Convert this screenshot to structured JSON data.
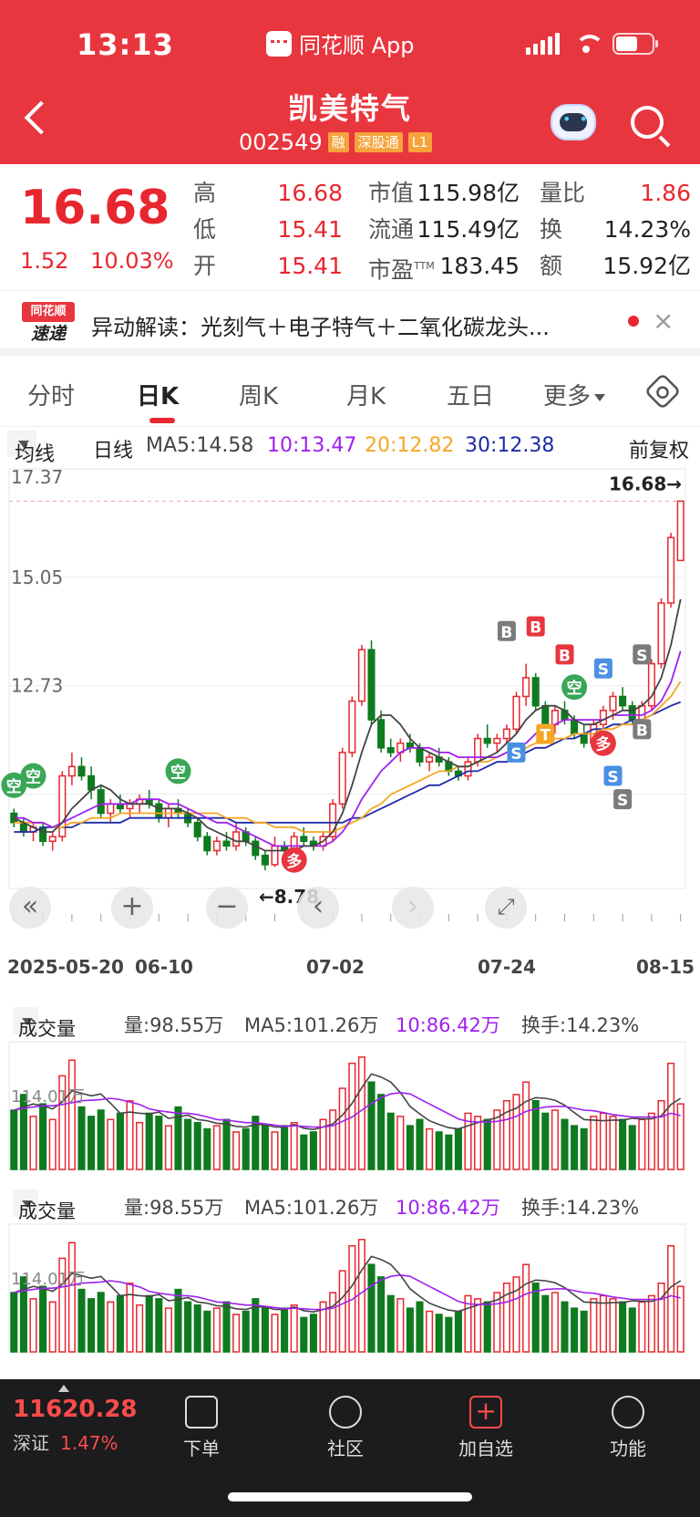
{
  "status_bar": {
    "time": "13:13",
    "app_name": "同花顺 App"
  },
  "header": {
    "title": "凯美特气",
    "code": "002549",
    "tags": [
      "融",
      "深股通",
      "L1"
    ]
  },
  "quote": {
    "price": "16.68",
    "change": "1.52",
    "change_pct": "10.03%",
    "rows": [
      {
        "k1": "高",
        "v1": "16.68",
        "k2": "市值",
        "v2": "115.98亿",
        "k3": "量比",
        "v3": "1.86"
      },
      {
        "k1": "低",
        "v1": "15.41",
        "k2": "流通",
        "v2": "115.49亿",
        "k3": "换",
        "v3": "14.23%"
      },
      {
        "k1": "开",
        "v1": "15.41",
        "k2": "市盈",
        "v2": "183.45",
        "k3": "额",
        "v3": "15.92亿"
      }
    ],
    "pe_sup": "TTM"
  },
  "news": {
    "logo_top": "同花顺",
    "logo_bottom": "速递",
    "text": "异动解读：光刻气＋电子特气＋二氧化碳龙头...",
    "close": "×"
  },
  "tabs": [
    {
      "label": "分时"
    },
    {
      "label": "日K"
    },
    {
      "label": "周K"
    },
    {
      "label": "月K"
    },
    {
      "label": "五日"
    },
    {
      "label": "更多"
    }
  ],
  "ma_bar": {
    "selector": "均线",
    "period": "日线",
    "ma5": "MA5:14.58",
    "ma10": "10:13.47",
    "ma20": "20:12.82",
    "ma30": "30:12.38",
    "adjust": "前复权"
  },
  "colors": {
    "up": "#e8262f",
    "down": "#0f7a1f",
    "ma5": "#444444",
    "ma10": "#a020f0",
    "ma20": "#f5a623",
    "ma30": "#1f2aa8"
  },
  "chart_data": {
    "type": "candlestick",
    "y_ticks": [
      "17.37",
      "15.05",
      "12.73"
    ],
    "y_range": [
      8.39,
      17.37
    ],
    "last_price_label": "16.68→",
    "low_label": "←8.78",
    "dates": [
      "2025-05-20",
      "06-10",
      "07-02",
      "07-24",
      "08-15"
    ],
    "candles": [
      [
        10.0,
        10.1,
        9.7,
        9.8
      ],
      [
        9.8,
        9.9,
        9.5,
        9.6
      ],
      [
        9.6,
        9.8,
        9.4,
        9.7
      ],
      [
        9.7,
        9.8,
        9.3,
        9.4
      ],
      [
        9.4,
        9.6,
        9.2,
        9.5
      ],
      [
        9.5,
        10.9,
        9.4,
        10.8
      ],
      [
        10.8,
        11.3,
        10.6,
        11.0
      ],
      [
        11.0,
        11.2,
        10.7,
        10.8
      ],
      [
        10.8,
        11.0,
        10.3,
        10.5
      ],
      [
        10.5,
        10.6,
        9.9,
        10.0
      ],
      [
        10.0,
        10.3,
        9.8,
        10.2
      ],
      [
        10.2,
        10.4,
        10.0,
        10.1
      ],
      [
        10.1,
        10.3,
        9.9,
        10.2
      ],
      [
        10.2,
        10.4,
        10.0,
        10.3
      ],
      [
        10.3,
        10.5,
        10.1,
        10.2
      ],
      [
        10.2,
        10.3,
        9.8,
        9.9
      ],
      [
        9.9,
        10.2,
        9.7,
        10.1
      ],
      [
        10.1,
        10.3,
        9.9,
        10.0
      ],
      [
        10.0,
        10.1,
        9.7,
        9.8
      ],
      [
        9.8,
        9.9,
        9.4,
        9.5
      ],
      [
        9.5,
        9.6,
        9.1,
        9.2
      ],
      [
        9.2,
        9.5,
        9.1,
        9.4
      ],
      [
        9.4,
        9.6,
        9.2,
        9.3
      ],
      [
        9.3,
        9.8,
        9.2,
        9.6
      ],
      [
        9.6,
        9.7,
        9.3,
        9.4
      ],
      [
        9.4,
        9.5,
        9.0,
        9.1
      ],
      [
        9.1,
        9.2,
        8.78,
        8.9
      ],
      [
        8.9,
        9.5,
        8.85,
        9.3
      ],
      [
        9.3,
        9.4,
        9.1,
        9.2
      ],
      [
        9.2,
        9.6,
        9.1,
        9.5
      ],
      [
        9.5,
        9.7,
        9.3,
        9.4
      ],
      [
        9.4,
        9.5,
        9.2,
        9.3
      ],
      [
        9.3,
        9.6,
        9.2,
        9.5
      ],
      [
        9.5,
        10.3,
        9.4,
        10.2
      ],
      [
        10.2,
        11.4,
        10.1,
        11.3
      ],
      [
        11.3,
        12.5,
        11.2,
        12.4
      ],
      [
        12.4,
        13.6,
        12.3,
        13.5
      ],
      [
        13.5,
        13.7,
        11.9,
        12.0
      ],
      [
        12.0,
        12.2,
        11.3,
        11.4
      ],
      [
        11.4,
        11.6,
        11.2,
        11.3
      ],
      [
        11.3,
        11.6,
        11.1,
        11.5
      ],
      [
        11.5,
        11.7,
        11.3,
        11.4
      ],
      [
        11.4,
        11.5,
        11.0,
        11.1
      ],
      [
        11.1,
        11.3,
        10.9,
        11.2
      ],
      [
        11.2,
        11.4,
        11.0,
        11.1
      ],
      [
        11.1,
        11.2,
        10.8,
        10.9
      ],
      [
        10.9,
        11.0,
        10.7,
        10.8
      ],
      [
        10.8,
        11.2,
        10.7,
        11.1
      ],
      [
        11.1,
        11.7,
        11.0,
        11.6
      ],
      [
        11.6,
        11.9,
        11.4,
        11.5
      ],
      [
        11.5,
        11.7,
        11.3,
        11.6
      ],
      [
        11.6,
        11.9,
        11.5,
        11.8
      ],
      [
        11.8,
        12.6,
        11.7,
        12.5
      ],
      [
        12.5,
        13.2,
        12.3,
        12.9
      ],
      [
        12.9,
        13.0,
        12.2,
        12.3
      ],
      [
        12.3,
        12.4,
        11.8,
        11.9
      ],
      [
        11.9,
        12.3,
        11.7,
        12.2
      ],
      [
        12.2,
        12.4,
        11.9,
        12.0
      ],
      [
        12.0,
        12.1,
        11.6,
        11.7
      ],
      [
        11.7,
        11.9,
        11.4,
        11.5
      ],
      [
        11.5,
        12.0,
        11.4,
        11.9
      ],
      [
        11.9,
        12.3,
        11.8,
        12.2
      ],
      [
        12.2,
        12.6,
        12.0,
        12.5
      ],
      [
        12.5,
        12.7,
        12.2,
        12.3
      ],
      [
        12.3,
        12.4,
        11.9,
        12.0
      ],
      [
        12.0,
        12.4,
        11.9,
        12.3
      ],
      [
        12.3,
        13.3,
        12.2,
        13.2
      ],
      [
        13.2,
        14.6,
        13.1,
        14.5
      ],
      [
        14.5,
        16.0,
        14.4,
        15.9
      ],
      [
        15.41,
        16.68,
        15.41,
        16.68
      ]
    ],
    "ma5": [
      9.9,
      9.8,
      9.7,
      9.6,
      9.6,
      9.8,
      10.1,
      10.3,
      10.5,
      10.6,
      10.5,
      10.3,
      10.2,
      10.2,
      10.2,
      10.1,
      10.1,
      10.1,
      10.0,
      9.9,
      9.7,
      9.6,
      9.5,
      9.4,
      9.4,
      9.3,
      9.2,
      9.2,
      9.2,
      9.2,
      9.3,
      9.3,
      9.4,
      9.6,
      10.0,
      10.6,
      11.3,
      11.9,
      12.1,
      12.1,
      11.9,
      11.6,
      11.4,
      11.3,
      11.2,
      11.1,
      11.0,
      11.0,
      11.1,
      11.2,
      11.3,
      11.5,
      11.7,
      12.0,
      12.2,
      12.3,
      12.3,
      12.2,
      12.0,
      11.9,
      11.9,
      12.0,
      12.1,
      12.2,
      12.2,
      12.3,
      12.5,
      12.9,
      13.6,
      14.58
    ],
    "ma10": [
      9.9,
      9.9,
      9.8,
      9.8,
      9.7,
      9.8,
      9.9,
      10.0,
      10.1,
      10.2,
      10.2,
      10.2,
      10.2,
      10.3,
      10.3,
      10.3,
      10.2,
      10.2,
      10.1,
      10.0,
      9.9,
      9.8,
      9.8,
      9.7,
      9.6,
      9.5,
      9.4,
      9.3,
      9.3,
      9.3,
      9.3,
      9.3,
      9.3,
      9.4,
      9.6,
      9.9,
      10.3,
      10.6,
      10.9,
      11.1,
      11.3,
      11.4,
      11.4,
      11.4,
      11.3,
      11.3,
      11.2,
      11.2,
      11.2,
      11.2,
      11.2,
      11.3,
      11.4,
      11.5,
      11.7,
      11.8,
      11.9,
      12.0,
      12.0,
      12.0,
      12.0,
      12.0,
      12.1,
      12.1,
      12.1,
      12.1,
      12.2,
      12.4,
      12.8,
      13.47
    ],
    "ma20": [
      9.8,
      9.8,
      9.8,
      9.8,
      9.7,
      9.7,
      9.8,
      9.8,
      9.9,
      9.9,
      9.9,
      10.0,
      10.0,
      10.0,
      10.0,
      10.0,
      10.0,
      10.0,
      10.0,
      10.0,
      10.0,
      10.0,
      9.9,
      9.9,
      9.9,
      9.8,
      9.8,
      9.7,
      9.7,
      9.7,
      9.6,
      9.6,
      9.6,
      9.6,
      9.7,
      9.8,
      9.9,
      10.1,
      10.2,
      10.4,
      10.5,
      10.6,
      10.7,
      10.8,
      10.9,
      10.9,
      11.0,
      11.0,
      11.1,
      11.1,
      11.2,
      11.3,
      11.3,
      11.4,
      11.5,
      11.5,
      11.6,
      11.6,
      11.7,
      11.7,
      11.7,
      11.8,
      11.8,
      11.9,
      11.9,
      12.0,
      12.1,
      12.3,
      12.5,
      12.82
    ],
    "ma30": [
      9.6,
      9.6,
      9.6,
      9.7,
      9.7,
      9.7,
      9.7,
      9.8,
      9.8,
      9.8,
      9.8,
      9.8,
      9.9,
      9.9,
      9.9,
      9.9,
      9.9,
      9.9,
      9.9,
      9.9,
      9.9,
      9.9,
      9.9,
      9.8,
      9.8,
      9.8,
      9.8,
      9.8,
      9.8,
      9.8,
      9.8,
      9.8,
      9.8,
      9.8,
      9.8,
      9.9,
      9.9,
      10.0,
      10.1,
      10.2,
      10.3,
      10.4,
      10.5,
      10.6,
      10.6,
      10.7,
      10.8,
      10.9,
      10.9,
      11.0,
      11.1,
      11.1,
      11.2,
      11.3,
      11.4,
      11.4,
      11.5,
      11.6,
      11.6,
      11.7,
      11.8,
      11.8,
      11.9,
      11.9,
      12.0,
      12.0,
      12.1,
      12.2,
      12.3,
      12.38
    ],
    "signals": [
      {
        "label": "空",
        "type": "circle-green",
        "i": 0,
        "y": 10.6
      },
      {
        "label": "空",
        "type": "circle-green",
        "i": 2,
        "y": 10.8
      },
      {
        "label": "空",
        "type": "circle-green",
        "i": 17,
        "y": 10.9
      },
      {
        "label": "多",
        "type": "circle-red",
        "i": 29,
        "y": 9.0
      },
      {
        "label": "B",
        "type": "sq-gray",
        "i": 51,
        "y": 13.9
      },
      {
        "label": "B",
        "type": "sq-red",
        "i": 54,
        "y": 14.0
      },
      {
        "label": "B",
        "type": "sq-red",
        "i": 57,
        "y": 13.4
      },
      {
        "label": "空",
        "type": "circle-green",
        "i": 58,
        "y": 12.7
      },
      {
        "label": "S",
        "type": "sq-blue",
        "i": 52,
        "y": 11.3
      },
      {
        "label": "T",
        "type": "sq-orange",
        "i": 55,
        "y": 11.7
      },
      {
        "label": "S",
        "type": "sq-blue",
        "i": 61,
        "y": 13.1
      },
      {
        "label": "S",
        "type": "sq-gray",
        "i": 65,
        "y": 13.4
      },
      {
        "label": "多",
        "type": "circle-red",
        "i": 61,
        "y": 11.5
      },
      {
        "label": "B",
        "type": "sq-gray",
        "i": 65,
        "y": 11.8
      },
      {
        "label": "S",
        "type": "sq-blue",
        "i": 62,
        "y": 10.8
      },
      {
        "label": "S",
        "type": "sq-gray",
        "i": 63,
        "y": 10.3
      }
    ],
    "volume": [
      95,
      120,
      85,
      105,
      80,
      150,
      175,
      100,
      85,
      95,
      80,
      90,
      110,
      75,
      90,
      85,
      70,
      100,
      80,
      75,
      65,
      70,
      80,
      60,
      65,
      85,
      70,
      60,
      70,
      75,
      55,
      60,
      80,
      95,
      130,
      170,
      180,
      140,
      120,
      90,
      85,
      70,
      80,
      65,
      60,
      55,
      65,
      90,
      85,
      80,
      95,
      110,
      120,
      140,
      110,
      90,
      95,
      80,
      70,
      65,
      85,
      90,
      85,
      80,
      70,
      80,
      90,
      110,
      170,
      105
    ],
    "volume_ma5": [
      95,
      100,
      105,
      102,
      97,
      108,
      126,
      122,
      118,
      121,
      106,
      90,
      92,
      90,
      89,
      92,
      82,
      84,
      87,
      80,
      78,
      74,
      73,
      69,
      68,
      72,
      72,
      68,
      68,
      72,
      66,
      64,
      68,
      73,
      87,
      106,
      131,
      153,
      148,
      140,
      123,
      101,
      89,
      78,
      72,
      67,
      65,
      70,
      75,
      79,
      83,
      92,
      98,
      109,
      115,
      114,
      111,
      103,
      91,
      80,
      79,
      78,
      79,
      79,
      82,
      81,
      81,
      86,
      104,
      114
    ],
    "volume_ma10": [
      95,
      98,
      100,
      102,
      102,
      104,
      107,
      110,
      111,
      112,
      114,
      112,
      108,
      104,
      97,
      94,
      92,
      90,
      90,
      88,
      84,
      80,
      79,
      77,
      75,
      75,
      73,
      71,
      69,
      70,
      69,
      68,
      68,
      70,
      77,
      84,
      95,
      106,
      115,
      121,
      123,
      121,
      113,
      105,
      97,
      89,
      81,
      77,
      76,
      76,
      77,
      80,
      85,
      93,
      97,
      100,
      101,
      101,
      98,
      95,
      94,
      91,
      88,
      86,
      84,
      84,
      84,
      84,
      90,
      86.42
    ]
  },
  "volume_panels": [
    {
      "selector": "成交量",
      "vol": "量:98.55万",
      "ma5": "MA5:101.26万",
      "ma10": "10:86.42万",
      "turnover": "换手:14.23%",
      "axis": "114.01万"
    },
    {
      "selector": "成交量",
      "vol": "量:98.55万",
      "ma5": "MA5:101.26万",
      "ma10": "10:86.42万",
      "turnover": "换手:14.23%",
      "axis": "114.01万"
    }
  ],
  "bottom_bar": {
    "index_value": "11620.28",
    "index_name": "深证",
    "index_pct": "1.47%",
    "items": [
      {
        "label": "下单"
      },
      {
        "label": "社区"
      },
      {
        "label": "加自选"
      },
      {
        "label": "功能"
      }
    ]
  }
}
